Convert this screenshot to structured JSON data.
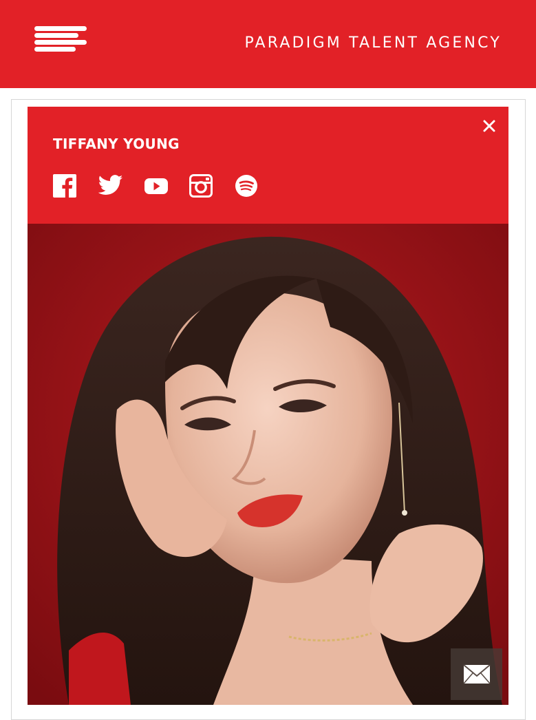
{
  "header": {
    "brand": "PARADIGM TALENT AGENCY",
    "menu_icon": "hamburger-menu-icon",
    "background": "#e22127"
  },
  "artist_panel": {
    "name": "TIFFANY YOUNG",
    "close_icon": "close-icon",
    "socials": [
      {
        "icon": "facebook-icon"
      },
      {
        "icon": "twitter-icon"
      },
      {
        "icon": "youtube-icon"
      },
      {
        "icon": "instagram-icon"
      },
      {
        "icon": "spotify-icon"
      }
    ]
  },
  "photo": {
    "subject_icon": "artist-portrait"
  },
  "contact": {
    "icon": "mail-icon"
  },
  "colors": {
    "accent": "#e22127",
    "backdrop": "#a0141a"
  }
}
